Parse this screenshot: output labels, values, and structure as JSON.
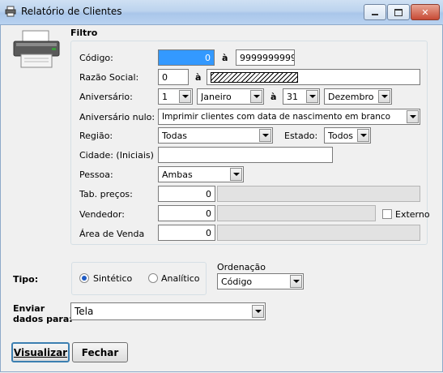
{
  "window": {
    "title": "Relatório de Clientes"
  },
  "filtro": {
    "header": "Filtro",
    "codigo": {
      "label": "Código:",
      "from": "0",
      "sep": "à",
      "to": "9999999999"
    },
    "razao_social": {
      "label": "Razão Social:",
      "from": "0",
      "sep": "à"
    },
    "aniversario": {
      "label": "Aniversário:",
      "day_from": "1",
      "month_from": "Janeiro",
      "sep": "à",
      "day_to": "31",
      "month_to": "Dezembro"
    },
    "aniversario_nulo": {
      "label": "Aniversário nulo:",
      "value": "Imprimir clientes com data de nascimento em branco"
    },
    "regiao": {
      "label": "Região:",
      "value": "Todas"
    },
    "estado": {
      "label": "Estado:",
      "value": "Todos"
    },
    "cidade": {
      "label": "Cidade: (Iniciais)",
      "value": ""
    },
    "pessoa": {
      "label": "Pessoa:",
      "value": "Ambas"
    },
    "tab_precos": {
      "label": "Tab. preços:",
      "value": "0"
    },
    "vendedor": {
      "label": "Vendedor:",
      "value": "0",
      "externo_label": "Externo"
    },
    "area_venda": {
      "label": "Área de Venda",
      "value": "0"
    }
  },
  "tipo": {
    "label": "Tipo:",
    "options": [
      "Sintético",
      "Analítico"
    ],
    "selected": "Sintético"
  },
  "ordenacao": {
    "label": "Ordenação",
    "value": "Código"
  },
  "enviar": {
    "label_line1": "Enviar",
    "label_line2": "dados para:",
    "value": "Tela"
  },
  "buttons": {
    "visualizar": "Visualizar",
    "fechar": "Fechar"
  },
  "colors": {
    "title_gradient": "#bcd3ee",
    "selection": "#3399ff",
    "default_border": "#3c7fb1"
  }
}
